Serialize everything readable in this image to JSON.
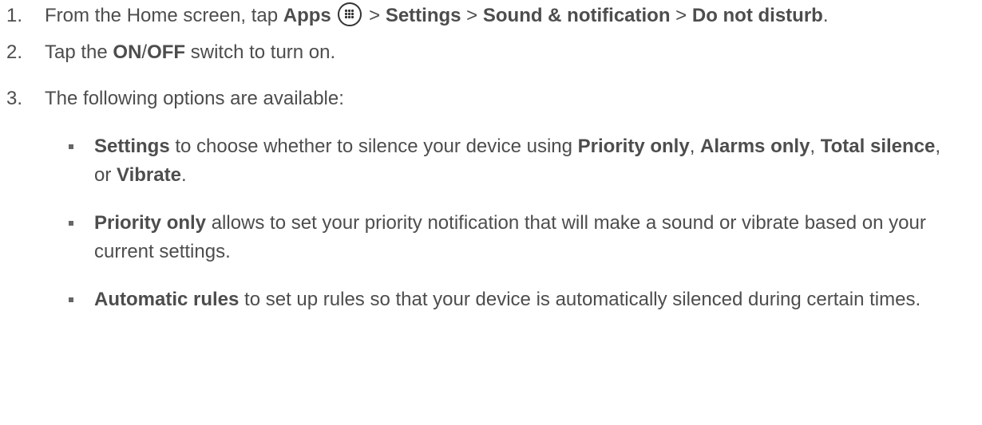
{
  "steps": [
    {
      "number": "1.",
      "text_from": "From the Home screen, tap ",
      "apps": "Apps",
      "apps_icon": "apps-grid-icon",
      "sep1": " > ",
      "settings": "Settings",
      "sep2": " > ",
      "sound": "Sound & notification",
      "sep3": " > ",
      "dnd": "Do not disturb",
      "end": "."
    },
    {
      "number": "2.",
      "text_tap": "Tap the ",
      "on": "ON",
      "slash": "/",
      "off": "OFF",
      "text_rest": " switch to turn on."
    },
    {
      "number": "3.",
      "text": "The following options are available:"
    }
  ],
  "options": [
    {
      "term": "Settings",
      "t1": " to choose whether to silence your device using ",
      "b1": "Priority only",
      "t2": ", ",
      "b2": "Alarms only",
      "t3": ", ",
      "b3": "Total silence",
      "t4": ", or ",
      "b4": "Vibrate",
      "t5": "."
    },
    {
      "term": "Priority only",
      "text": " allows to set your priority notification that will make a sound or vibrate based on your current settings."
    },
    {
      "term": "Automatic rules",
      "text": " to set up rules so that your device is automatically silenced during certain times."
    }
  ]
}
